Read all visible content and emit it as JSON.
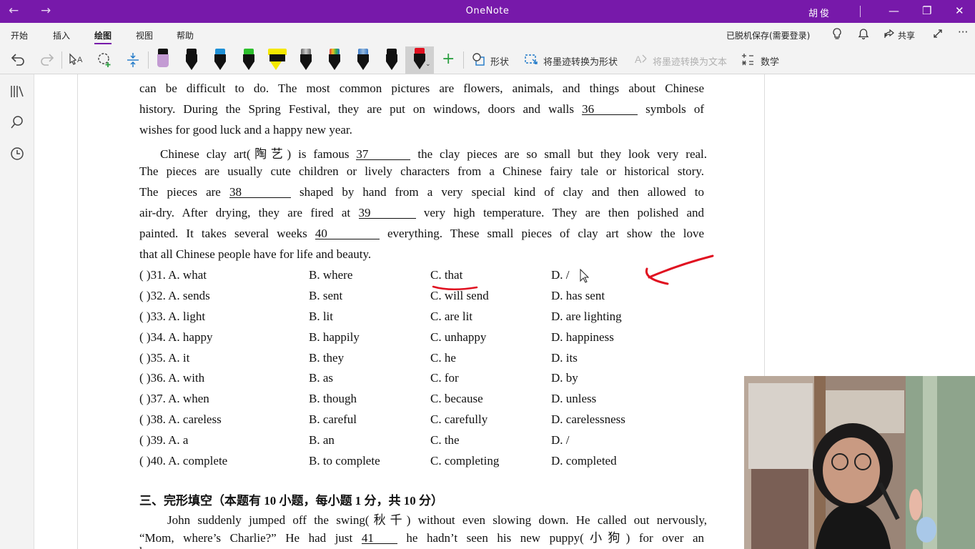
{
  "window": {
    "title": "OneNote",
    "user": "胡俊",
    "back_icon": "←",
    "forward_icon": "→",
    "minimize_icon": "—",
    "restore_icon": "❐",
    "close_icon": "✕"
  },
  "tabs": [
    "开始",
    "插入",
    "绘图",
    "视图",
    "帮助"
  ],
  "tabs_right": {
    "status": "已脱机保存(需要登录)",
    "share": "共享"
  },
  "toolbar": {
    "shapes_label": "形状",
    "ink_to_shape": "将墨迹转换为形状",
    "ink_to_text": "将墨迹转换为文本",
    "math_label": "数学",
    "pens": [
      {
        "name": "eraser",
        "cap": "#c39bd3"
      },
      {
        "name": "pen-black",
        "cap": "#111111"
      },
      {
        "name": "pen-blue",
        "cap": "#1e90d6"
      },
      {
        "name": "pen-green",
        "cap": "#2ec02e"
      },
      {
        "name": "highlighter-yellow",
        "cap": "#f5e800"
      },
      {
        "name": "pen-galaxy",
        "cap": "#888888"
      },
      {
        "name": "pen-rainbow",
        "cap": "#e04040"
      },
      {
        "name": "pen-ocean",
        "cap": "#3a7ac8"
      },
      {
        "name": "pen-black-2",
        "cap": "#111111"
      },
      {
        "name": "pen-red",
        "cap": "#e01020"
      }
    ]
  },
  "document": {
    "lines": [
      {
        "pre": "can be difficult to do. The most common pictures are flowers, animals, and things about Chinese",
        "blank": "",
        "post": ""
      },
      {
        "pre": "history. During the Spring Festival, they are put on windows, doors and walls",
        "blank": "36",
        "post": "symbols of"
      },
      {
        "pre": "wishes for good luck and a happy new year.",
        "blank": "",
        "post": ""
      },
      {
        "pre": "Chinese clay art(陶艺) is famous",
        "blank": "37",
        "post": "the clay pieces are so small but they look very real."
      },
      {
        "pre": "The pieces are usually cute children or lively characters from a Chinese fairy tale or historical story.",
        "blank": "",
        "post": ""
      },
      {
        "pre": "The pieces are",
        "blank": "38",
        "post": "shaped by hand from a very special kind of clay and then allowed to"
      },
      {
        "pre": "air-dry. After drying, they are fired at",
        "blank": "39",
        "post": "very high temperature. They are then polished and"
      },
      {
        "pre": "painted. It takes several weeks",
        "blank": "40",
        "post": "everything. These small pieces of clay art show the love"
      },
      {
        "pre": "that all Chinese people have for life and beauty.",
        "blank": "",
        "post": ""
      }
    ],
    "questions": [
      {
        "num": "(      )31. A. what",
        "b": "B. where",
        "c": "C. that",
        "d": "D. /"
      },
      {
        "num": "(      )32. A. sends",
        "b": "B. sent",
        "c": "C. will send",
        "d": "D. has sent"
      },
      {
        "num": "(      )33. A. light",
        "b": "B. lit",
        "c": "C. are lit",
        "d": "D. are lighting"
      },
      {
        "num": "(      )34. A. happy",
        "b": "B. happily",
        "c": "C. unhappy",
        "d": "D. happiness"
      },
      {
        "num": "(      )35. A. it",
        "b": "B. they",
        "c": "C. he",
        "d": "D. its"
      },
      {
        "num": "(      )36. A. with",
        "b": "B. as",
        "c": "C. for",
        "d": "D. by"
      },
      {
        "num": "(      )37. A. when",
        "b": "B. though",
        "c": "C. because",
        "d": "D. unless"
      },
      {
        "num": "(      )38. A. careless",
        "b": "B. careful",
        "c": "C. carefully",
        "d": "D. carelessness"
      },
      {
        "num": "(      )39. A. a",
        "b": "B. an",
        "c": "C. the",
        "d": "D. /"
      },
      {
        "num": "(      )40. A. complete",
        "b": "B. to complete",
        "c": "C. completing",
        "d": "D. completed"
      }
    ],
    "section_title": "三、完形填空（本题有 10 小题，每小题 1 分，共 10 分）",
    "story_line1": "John suddenly jumped off the swing(秋千) without even slowing down. He called out nervously,",
    "story_line2_pre": "“Mom, where’s Charlie?” He had just",
    "story_line2_blank": "41",
    "story_line2_post": "he hadn’t seen his new puppy(小狗) for over an",
    "story_line3": "h"
  },
  "colors": {
    "titlebar": "#7719aa",
    "ink": "#e01020"
  }
}
